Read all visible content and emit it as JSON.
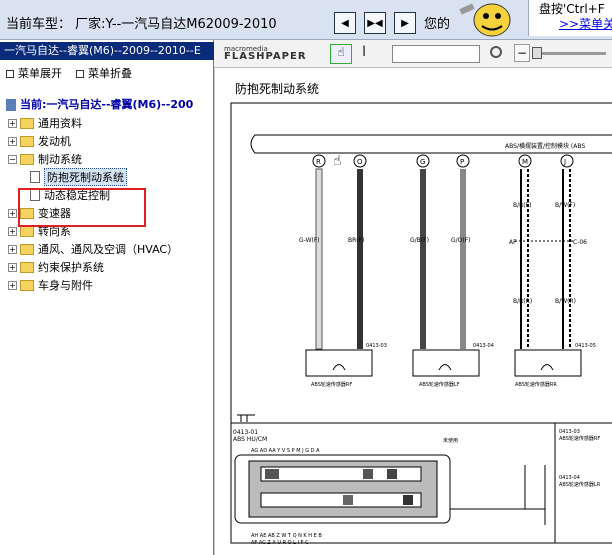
{
  "topbar": {
    "car_label": "当前车型：  厂家:Y--一汽马自达M62009-2010",
    "find_partial": "您的",
    "hint_line1": "盘按'Ctrl+F",
    "hint_link": ">>菜单关"
  },
  "nav_buttons": [
    "◀",
    "▶◀",
    "▶"
  ],
  "left_panel": {
    "title": "一汽马自达--睿翼(M6)--2009--2010--E",
    "expand_menu": "菜单展开",
    "collapse_menu": "菜单折叠",
    "current": "当前:一汽马自达--睿翼(M6)--200",
    "tree": [
      {
        "label": "通用资料",
        "state": "+"
      },
      {
        "label": "发动机",
        "state": "+"
      },
      {
        "label": "制动系统",
        "state": "-"
      },
      {
        "label": "防抱死制动系统",
        "state": "leaf-selected"
      },
      {
        "label": "动态稳定控制",
        "state": "leaf"
      },
      {
        "label": "变速器",
        "state": "+"
      },
      {
        "label": "转向系",
        "state": "+"
      },
      {
        "label": "通风、通风及空调（HVAC）",
        "state": "+"
      },
      {
        "label": "约束保护系统",
        "state": "+"
      },
      {
        "label": "车身与附件",
        "state": "+"
      }
    ]
  },
  "viewer": {
    "logo_small": "macromedia",
    "logo_big": "FLASHPAPER",
    "doc_title": "防抱死制动系统",
    "module_label": "ABS/横摆装置/控制模块 (ABS",
    "connectors": [
      "R",
      "O",
      "G",
      "P",
      "M",
      "J"
    ],
    "wires": [
      "G-W(F)",
      "BR(F)",
      "G/B(F)",
      "G/O(F)",
      "B/R(F)",
      "B/W(F)",
      "AF",
      "C-06",
      "B/R(R)",
      "B/W(R)"
    ],
    "sensor_ids": [
      "0413-03",
      "0413-04",
      "0413-05"
    ],
    "sensors": [
      "ABS轮速传感器RF",
      "ABS轮速传感器LF",
      "ABS轮速传感器RR"
    ],
    "hu_id": "0413-01",
    "hu_label": "ABS HU/CM",
    "unused_label": "未使用",
    "right_notes": [
      "0413-03",
      "ABS轮速传感器RF",
      "0413-04",
      "ABS轮速传感器LR"
    ],
    "pins_top": "AG AD AA Y  V  S  P  M  J  G  D  A",
    "pins_bottom": "AH AE AB Z  W  T  Q  N  K  H  E  B",
    "pins_bottom2": "AF AC Z  X  U  R  O  L  I  F  C"
  }
}
